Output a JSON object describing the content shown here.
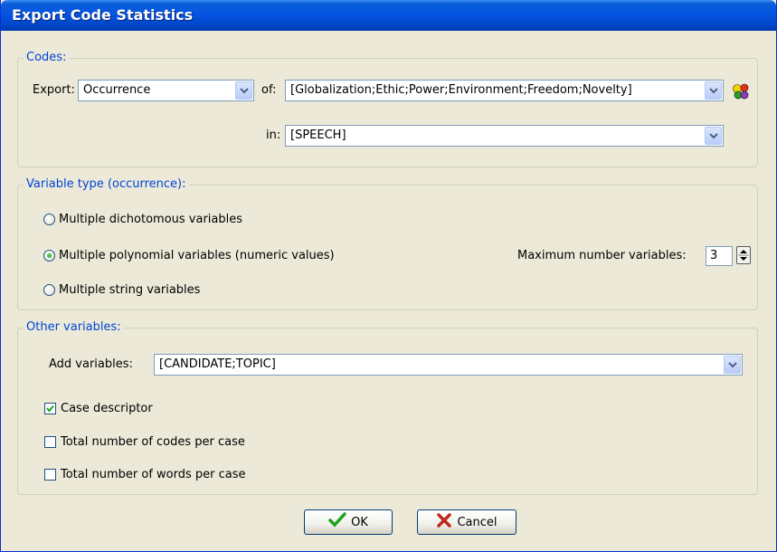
{
  "window": {
    "title": "Export Code Statistics"
  },
  "codes": {
    "legend": "Codes:",
    "export_label": "Export:",
    "export_value": "Occurrence",
    "of_label": "of:",
    "of_value": "[Globalization;Ethic;Power;Environment;Freedom;Novelty]",
    "in_label": "in:",
    "in_value": "[SPEECH]"
  },
  "variable_type": {
    "legend": "Variable type (occurrence):",
    "options": [
      {
        "label": "Multiple dichotomous variables",
        "selected": false
      },
      {
        "label": "Multiple polynomial variables (numeric values)",
        "selected": true
      },
      {
        "label": "Multiple string variables",
        "selected": false
      }
    ],
    "max_label": "Maximum number variables:",
    "max_value": "3"
  },
  "other": {
    "legend": "Other variables:",
    "add_label": "Add variables:",
    "add_value": "[CANDIDATE;TOPIC]",
    "checks": [
      {
        "label": "Case descriptor",
        "checked": true
      },
      {
        "label": "Total number of codes per case",
        "checked": false
      },
      {
        "label": "Total number of words per case",
        "checked": false
      }
    ]
  },
  "buttons": {
    "ok": "OK",
    "cancel": "Cancel"
  },
  "icons": {
    "ok": "checkmark-icon",
    "cancel": "x-icon",
    "codes": "color-balls-icon",
    "dropdown": "chevron-down-icon"
  },
  "colors": {
    "accent": "#0046d5",
    "title_bar": "#0554e0",
    "face": "#ece9d8",
    "check_green": "#21a121",
    "cancel_red": "#c0281e"
  }
}
